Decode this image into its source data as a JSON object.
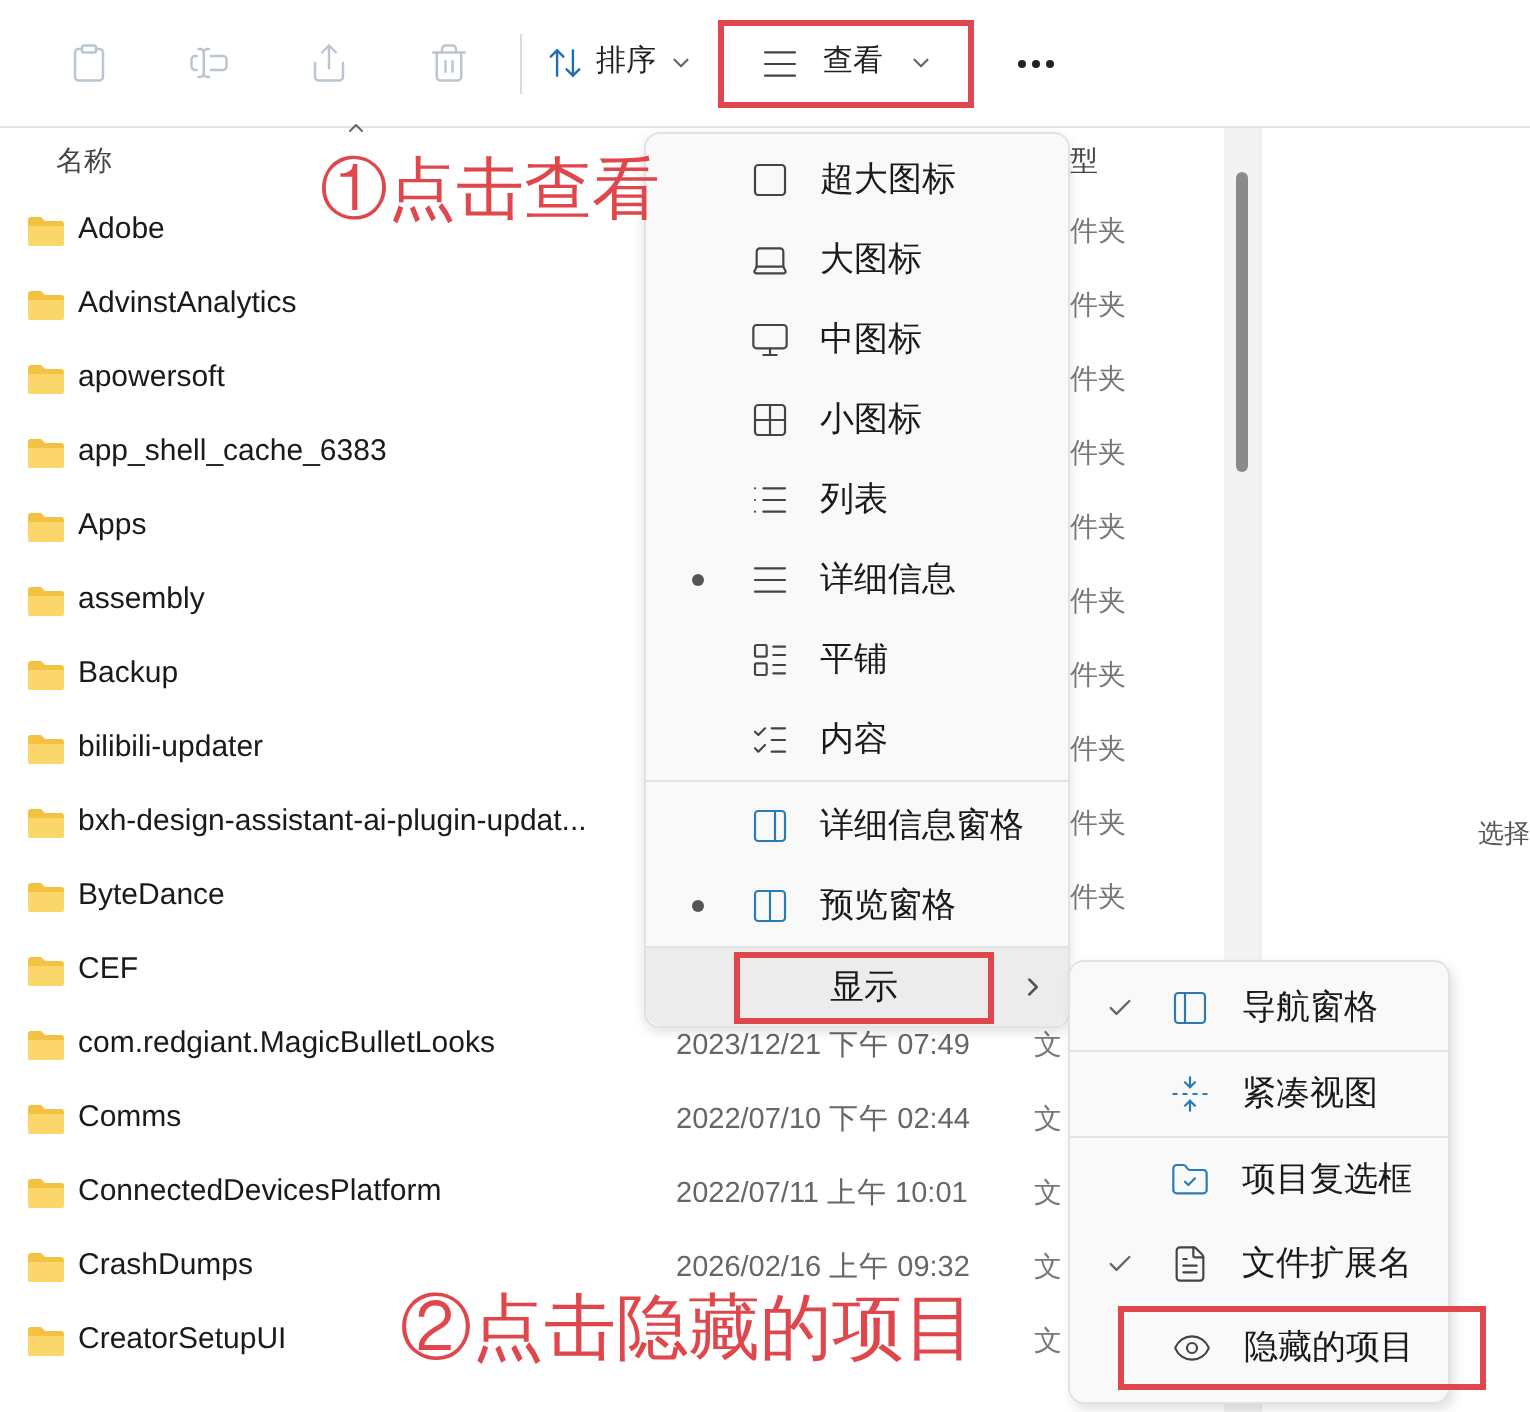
{
  "toolbar": {
    "icon_buttons": [
      {
        "kind": "paste",
        "disabled": true
      },
      {
        "kind": "rename",
        "disabled": true
      },
      {
        "kind": "share",
        "disabled": true
      },
      {
        "kind": "delete",
        "disabled": true
      }
    ],
    "sort_button": {
      "label": "排序"
    },
    "view_button": {
      "label": "查看",
      "highlighted": true
    }
  },
  "file_list": {
    "columns": [
      {
        "label": "名称"
      },
      {
        "label": "型"
      }
    ],
    "rows": [
      {
        "name": "Adobe",
        "type": "件夹"
      },
      {
        "name": "AdvinstAnalytics",
        "type": "件夹"
      },
      {
        "name": "apowersoft",
        "type": "件夹"
      },
      {
        "name": "app_shell_cache_6383",
        "type": "件夹"
      },
      {
        "name": "Apps",
        "type": "件夹"
      },
      {
        "name": "assembly",
        "type": "件夹"
      },
      {
        "name": "Backup",
        "type": "件夹"
      },
      {
        "name": "bilibili-updater",
        "type": "件夹"
      },
      {
        "name": "bxh-design-assistant-ai-plugin-updat...",
        "type": "件夹"
      },
      {
        "name": "ByteDance",
        "type": "件夹"
      },
      {
        "name": "CEF"
      },
      {
        "name": "com.redgiant.MagicBulletLooks",
        "date": "2023/12/21 下午 07:49",
        "type": "文"
      },
      {
        "name": "Comms",
        "date": "2022/07/10 下午 02:44",
        "type": "文"
      },
      {
        "name": "ConnectedDevicesPlatform",
        "date": "2022/07/11 上午 10:01",
        "type": "文"
      },
      {
        "name": "CrashDumps",
        "date": "2026/02/16 上午 09:32",
        "type": "文"
      },
      {
        "name": "CreatorSetupUI",
        "type": "文"
      }
    ]
  },
  "details_pane": {
    "text": "选择"
  },
  "view_menu": {
    "groups": [
      [
        {
          "label": "超大图标",
          "selected": false
        },
        {
          "label": "大图标",
          "selected": false
        },
        {
          "label": "中图标",
          "selected": false
        },
        {
          "label": "小图标",
          "selected": false
        },
        {
          "label": "列表",
          "selected": false
        },
        {
          "label": "详细信息",
          "selected": true
        },
        {
          "label": "平铺",
          "selected": false
        },
        {
          "label": "内容",
          "selected": false
        }
      ],
      [
        {
          "label": "详细信息窗格",
          "selected": false
        },
        {
          "label": "预览窗格",
          "selected": true
        }
      ]
    ],
    "show_item": {
      "label": "显示",
      "highlighted": true
    }
  },
  "show_submenu": {
    "groups": [
      [
        {
          "label": "导航窗格",
          "checked": true,
          "highlighted": false
        }
      ],
      [
        {
          "label": "紧凑视图",
          "checked": false,
          "highlighted": false
        }
      ],
      [
        {
          "label": "项目复选框",
          "checked": false,
          "highlighted": false
        },
        {
          "label": "文件扩展名",
          "checked": true,
          "highlighted": false
        },
        {
          "label": "隐藏的项目",
          "checked": false,
          "highlighted": true
        }
      ]
    ]
  },
  "annotations": [
    {
      "text": "①点击查看"
    },
    {
      "text": "②点击隐藏的项目"
    }
  ]
}
